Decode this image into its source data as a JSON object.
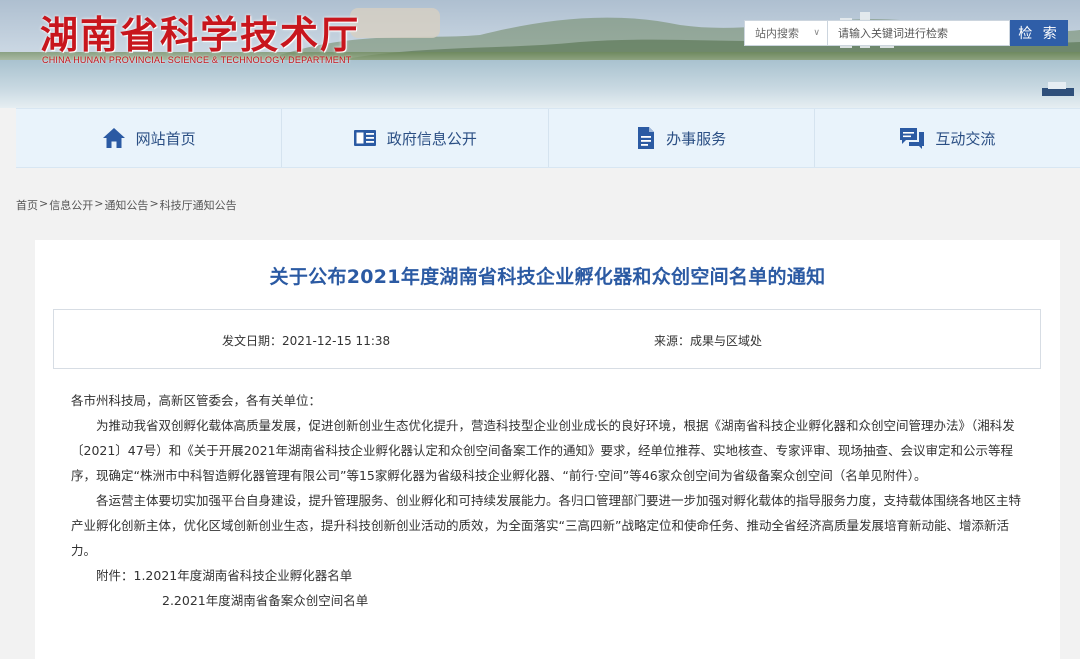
{
  "header": {
    "title": "湖南省科学技术厅",
    "subtitle": "CHINA HUNAN PROVINCIAL SCIENCE & TECHNOLOGY DEPARTMENT",
    "search": {
      "scope": "站内搜索",
      "placeholder": "请输入关键词进行检索",
      "button": "检 索"
    }
  },
  "nav": [
    {
      "label": "网站首页",
      "icon": "home-icon"
    },
    {
      "label": "政府信息公开",
      "icon": "book-icon"
    },
    {
      "label": "办事服务",
      "icon": "document-icon"
    },
    {
      "label": "互动交流",
      "icon": "chat-icon"
    }
  ],
  "breadcrumb": [
    "首页",
    "信息公开",
    "通知公告",
    "科技厅通知公告"
  ],
  "article": {
    "title": "关于公布2021年度湖南省科技企业孵化器和众创空间名单的通知",
    "date": "发文日期：2021-12-15 11:38",
    "source": "来源：成果与区域处",
    "salutation": "各市州科技局，高新区管委会，各有关单位：",
    "para1": "为推动我省双创孵化载体高质量发展，促进创新创业生态优化提升，营造科技型企业创业成长的良好环境，根据《湖南省科技企业孵化器和众创空间管理办法》（湘科发〔2021〕47号）和《关于开展2021年湖南省科技企业孵化器认定和众创空间备案工作的通知》要求，经单位推荐、实地核查、专家评审、现场抽查、会议审定和公示等程序，现确定“株洲市中科智造孵化器管理有限公司”等15家孵化器为省级科技企业孵化器、“前行·空间”等46家众创空间为省级备案众创空间（名单见附件）。",
    "para2": "各运营主体要切实加强平台自身建设，提升管理服务、创业孵化和可持续发展能力。各归口管理部门要进一步加强对孵化载体的指导服务力度，支持载体围绕各地区主特产业孵化创新主体，优化区域创新创业生态，提升科技创新创业活动的质效，为全面落实“三高四新”战略定位和使命任务、推动全省经济高质量发展培育新动能、增添新活力。",
    "attachment1": "附件：1.2021年度湖南省科技企业孵化器名单",
    "attachment2": "2.2021年度湖南省备案众创空间名单"
  },
  "colors": {
    "brand_red": "#c8161d",
    "nav_text": "#2b4f84",
    "title_blue": "#2b5aa3",
    "search_button": "#2f5ea8"
  }
}
